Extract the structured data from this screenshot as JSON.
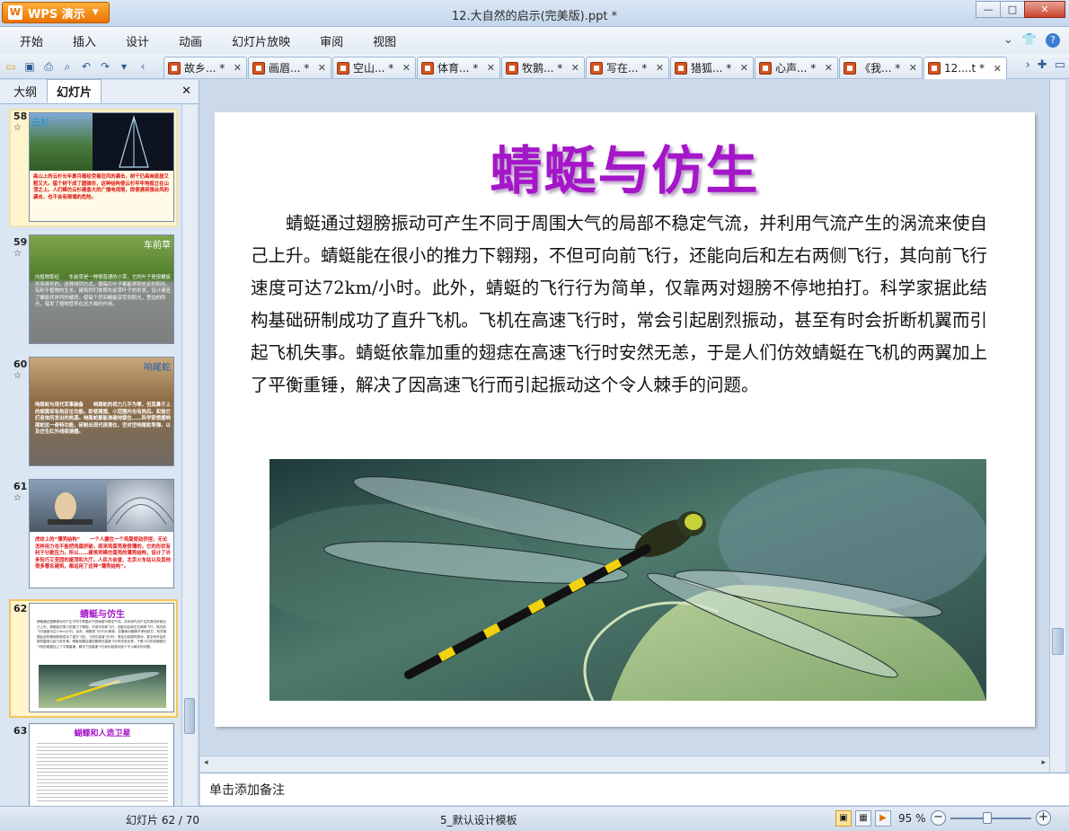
{
  "app": {
    "name": "WPS 演示",
    "window_title": "12.大自然的启示(完美版).ppt *"
  },
  "window_controls": {
    "minimize": "—",
    "maximize": "□",
    "close": "✕"
  },
  "menu": [
    "开始",
    "插入",
    "设计",
    "动画",
    "幻灯片放映",
    "审阅",
    "视图"
  ],
  "doc_tabs": [
    {
      "label": "故乡... *"
    },
    {
      "label": "画眉... *"
    },
    {
      "label": "空山... *"
    },
    {
      "label": "体育... *"
    },
    {
      "label": "牧鹅... *"
    },
    {
      "label": "写在... *"
    },
    {
      "label": "猎狐... *"
    },
    {
      "label": "心声... *"
    },
    {
      "label": "《我... *"
    },
    {
      "label": "12....t *",
      "active": true
    }
  ],
  "left_pane": {
    "tabs": [
      "大纲",
      "幻灯片"
    ],
    "active_tab": "幻灯片",
    "close": "✕",
    "thumbnails": [
      {
        "num": "58",
        "star": "☆",
        "caption": "云杉",
        "text": "高山上的云杉长年累月都经受着狂风的袭击，树干仍高耸挺拔又粗又大。猛个树干成了圆锥形，这种结构使云杉牢牢地挺立在山顶之上。人们模仿云杉建造大的广播电视塔，即使遇到强台风的袭击，也不会有倒塌的危险。"
      },
      {
        "num": "59",
        "star": "☆",
        "caption": "车前草",
        "text": "向植物取经　　车前草是一种很普通的小草，它的叶子是按螺旋形来排列的。这种排列方式，使每片叶子都能得到充足的阳光。有利于植物的生长。建筑师们依照车前草叶子的形状，设计建造了螺旋状排列的楼房。使每个房间都能享受到阳光，里边的阳光，蕴发了植物营养在这方面的作用。"
      },
      {
        "num": "60",
        "star": "☆",
        "caption": "响尾蛇",
        "text": "响尾蛇与现代军事装备　　响尾蛇的视力几乎为零，但其鼻子上的颊窝却有热定位功能。即使周围、小范围内也有热后。实验它们身体所发出的热源。响尾蛇都能准确地锁住……科学家根据响尾蛇这一奇特功能，研制出现代夜视仪，空对空响尾蛇导弹。以及仿生红外线探测器。"
      },
      {
        "num": "61",
        "star": "☆",
        "caption": "",
        "text": "虎纹上的“薄壳结构”　　一个人握住一个鸡蛋使劲挤捏，无论怎样用力也不能把鸡蛋挤破。原来鸡蛋壳是很薄的，它的形状有利于分散压力。所以……建筑师模仿蛋壳的薄壳结构，设计了许多轻巧又坚固的屋顶和大厅。人民大会堂、北京火车站以及其他很多著名建筑，都运用了这种“薄壳结构”。"
      },
      {
        "num": "62",
        "star": "",
        "caption": "蜻蜓与仿生",
        "selected": true
      },
      {
        "num": "63",
        "star": "",
        "caption": "蝴蝶和人造卫星"
      }
    ]
  },
  "slide": {
    "title": "蜻蜓与仿生",
    "body": "蜻蜓通过翅膀振动可产生不同于周围大气的局部不稳定气流，并利用气流产生的涡流来使自己上升。蜻蜓能在很小的推力下翱翔，不但可向前飞行，还能向后和左右两侧飞行，其向前飞行速度可达72km/小时。此外，蜻蜓的飞行行为简单，仅靠两对翅膀不停地拍打。科学家据此结构基础研制成功了直升飞机。飞机在高速飞行时，常会引起剧烈振动，甚至有时会折断机翼而引起飞机失事。蜻蜓依靠加重的翅痣在高速飞行时安然无恙，于是人们仿效蜻蜓在飞机的两翼加上了平衡重锤，解决了因高速飞行而引起振动这个令人棘手的问题。",
    "image": "dragonfly-photo"
  },
  "notes_placeholder": "单击添加备注",
  "status": {
    "slide_info": "幻灯片 62 / 70",
    "template": "5_默认设计模板",
    "zoom": "95 %",
    "zoom_minus": "−",
    "zoom_plus": "+"
  },
  "colors": {
    "title": "#a516c9",
    "accent": "#ea7300"
  }
}
